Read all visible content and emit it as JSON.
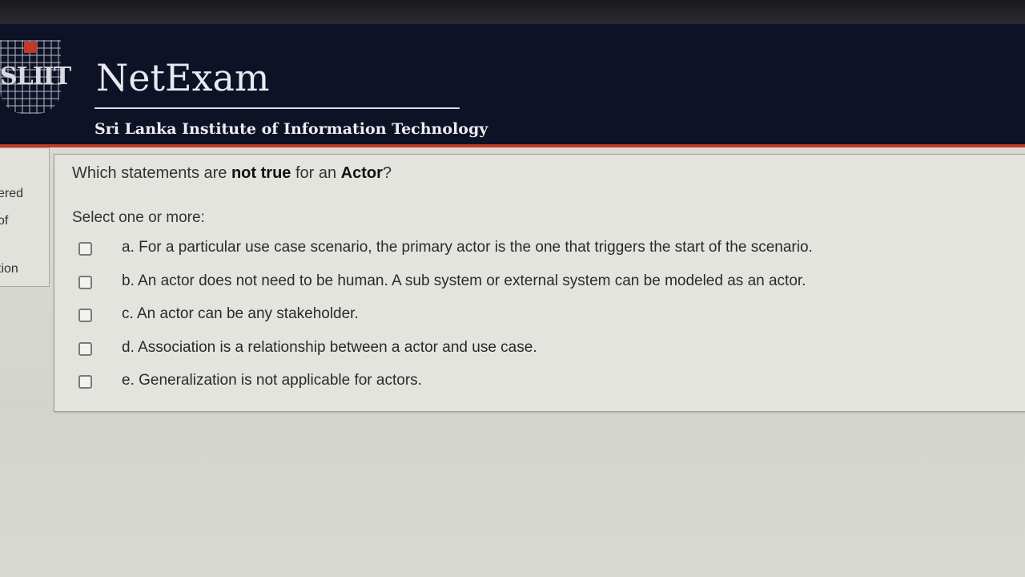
{
  "header": {
    "logo_text": "SLIIT",
    "brand": "NetExam",
    "subtitle": "Sri Lanka Institute of Information Technology"
  },
  "sidebar": {
    "fragments": [
      "ered",
      "of",
      "tion"
    ]
  },
  "question": {
    "text_before": "Which statements are ",
    "text_emph1": "not true",
    "text_middle": " for an ",
    "text_emph2": "Actor",
    "text_after": "?",
    "prompt": "Select one or more:",
    "options": [
      {
        "label": "a. For a particular use case scenario, the primary actor is the one that triggers the start of the scenario.",
        "checked": false
      },
      {
        "label": "b. An actor does not need to be human. A sub system or external system can be modeled as an actor.",
        "checked": false
      },
      {
        "label": "c. An actor can be any stakeholder.",
        "checked": false
      },
      {
        "label": "d. Association is a relationship between a actor and use case.",
        "checked": false
      },
      {
        "label": "e. Generalization is not applicable for actors.",
        "checked": false
      }
    ]
  },
  "colors": {
    "header_bg": "#0e1226",
    "header_accent": "#c0392b",
    "page_bg": "#d9d9d4"
  }
}
